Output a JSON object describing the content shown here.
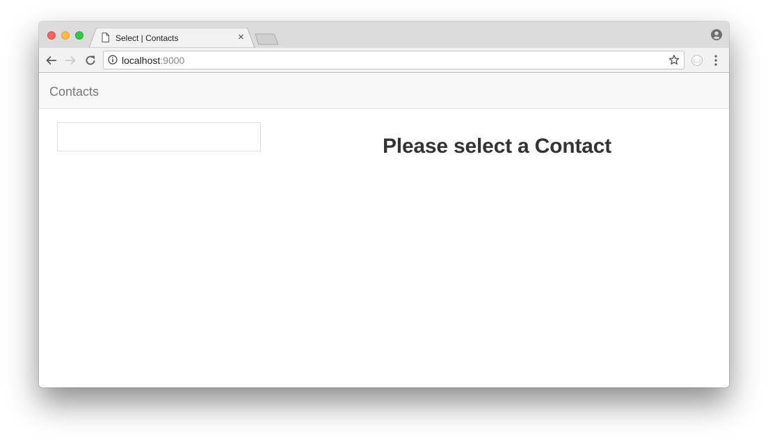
{
  "browser": {
    "tab": {
      "title": "Select | Contacts",
      "close_label": "×"
    },
    "address_bar": {
      "host": "localhost",
      "port": ":9000"
    }
  },
  "app": {
    "brand": "Contacts",
    "search": {
      "value": "",
      "placeholder": ""
    },
    "main": {
      "heading": "Please select a Contact"
    }
  }
}
